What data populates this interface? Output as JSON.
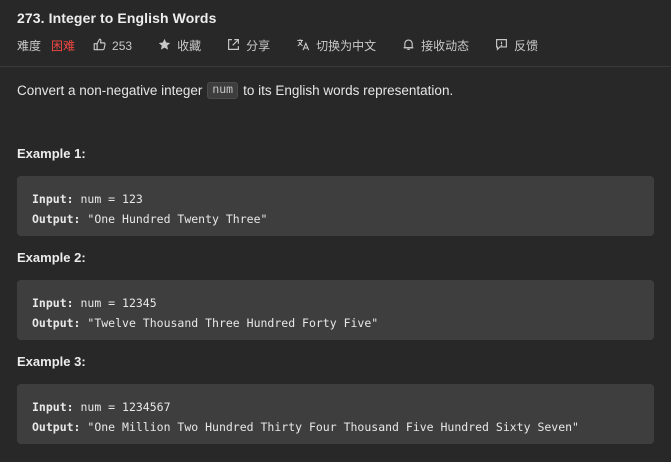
{
  "problem": {
    "title": "273. Integer to English Words"
  },
  "meta": {
    "difficulty_label": "难度",
    "difficulty": "困难",
    "likes": "253",
    "favorite": "收藏",
    "share": "分享",
    "switch_lang": "切换为中文",
    "subscribe": "接收动态",
    "feedback": "反馈",
    "difficulty_color": "#ef4743"
  },
  "description": {
    "before": "Convert a non-negative integer",
    "code": "num",
    "after": "to its English words representation."
  },
  "examples": [
    {
      "title": "Example 1:",
      "input_label": "Input:",
      "input_value": "num = 123",
      "output_label": "Output:",
      "output_value": "\"One Hundred Twenty Three\""
    },
    {
      "title": "Example 2:",
      "input_label": "Input:",
      "input_value": "num = 12345",
      "output_label": "Output:",
      "output_value": "\"Twelve Thousand Three Hundred Forty Five\""
    },
    {
      "title": "Example 3:",
      "input_label": "Input:",
      "input_value": "num = 1234567",
      "output_label": "Output:",
      "output_value": "\"One Million Two Hundred Thirty Four Thousand Five Hundred Sixty Seven\""
    }
  ],
  "icons": [
    "thumbs-up-icon",
    "star-icon",
    "share-icon",
    "translate-icon",
    "bell-icon",
    "feedback-icon"
  ]
}
